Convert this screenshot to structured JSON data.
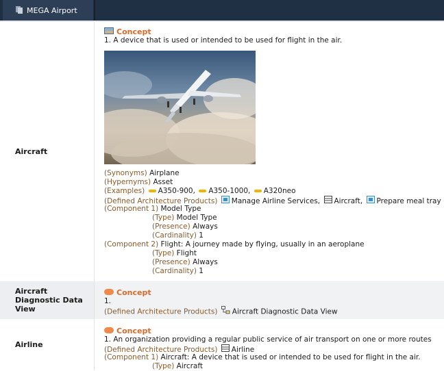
{
  "topbar": {
    "tab_label": "MEGA Airport"
  },
  "rows": {
    "aircraft": {
      "label": "Aircraft",
      "concept": "Concept",
      "definition": "1. A device that is used or intended to be used for flight in the air.",
      "synonyms_key": "(Synonyms)",
      "synonyms_val": "Airplane",
      "hypernyms_key": "(Hypernyms)",
      "hypernyms_val": "Asset",
      "examples_key": "(Examples)",
      "examples": [
        "A350-900,",
        "A350-1000,",
        "A320neo"
      ],
      "dap_key": "(Defined Architecture Products)",
      "dap": [
        "Manage Airline Services,",
        "Aircraft,",
        "Prepare meal tray"
      ],
      "comp1_key": "(Component 1)",
      "comp1_val": "Model Type",
      "comp1_type_key": "(Type)",
      "comp1_type_val": "Model Type",
      "comp1_presence_key": "(Presence)",
      "comp1_presence_val": "Always",
      "comp1_card_key": "(Cardinality)",
      "comp1_card_val": "1",
      "comp2_key": "(Component 2)",
      "comp2_val": "Flight: A journey made by flying, usually in an aeroplane",
      "comp2_type_key": "(Type)",
      "comp2_type_val": "Flight",
      "comp2_presence_key": "(Presence)",
      "comp2_presence_val": "Always",
      "comp2_card_key": "(Cardinality)",
      "comp2_card_val": "1"
    },
    "diag": {
      "label": "Aircraft Diagnostic Data View",
      "concept": "Concept",
      "definition": "1.",
      "dap_key": "(Defined Architecture Products)",
      "dap_val": "Aircraft Diagnostic Data View"
    },
    "airline": {
      "label": "Airline",
      "concept": "Concept",
      "definition": "1. An organization providing a regular public service of air transport on one or more routes",
      "dap_key": "(Defined Architecture Products)",
      "dap_val": "Airline",
      "comp1_key": "(Component 1)",
      "comp1_val": "Aircraft: A device that is used or intended to be used for flight in the air.",
      "type_key": "(Type)",
      "type_val": "Aircraft"
    }
  }
}
